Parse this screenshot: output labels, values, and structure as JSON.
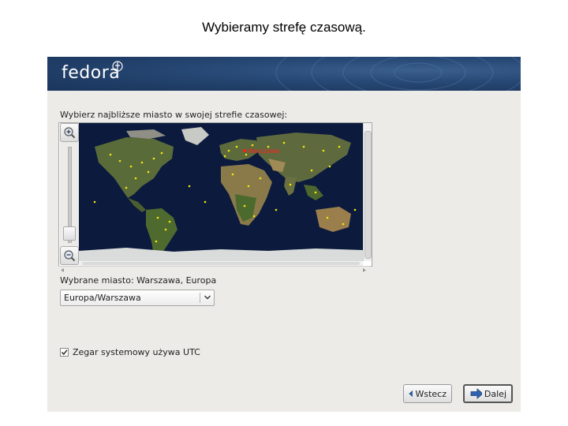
{
  "slide": {
    "title": "Wybieramy strefę czasową."
  },
  "header": {
    "logo_text": "fedora"
  },
  "timezone": {
    "instruction": "Wybierz najbliższe miasto w swojej strefie czasowej:",
    "selected_city_label": "Wybrane miasto: Warszawa, Europa",
    "map_city_label": "Warszawa",
    "combo_value": "Europa/Warszawa"
  },
  "options": {
    "utc_label": "Zegar systemowy używa UTC",
    "utc_checked": true
  },
  "buttons": {
    "back_label": "Wstecz",
    "next_label": "Dalej"
  },
  "colors": {
    "header_blue": "#1f3d66",
    "ocean": "#0b1a3d",
    "land_green": "#5a6b3a",
    "city_dot": "#f5e60a",
    "selected_city": "#ff2020"
  }
}
